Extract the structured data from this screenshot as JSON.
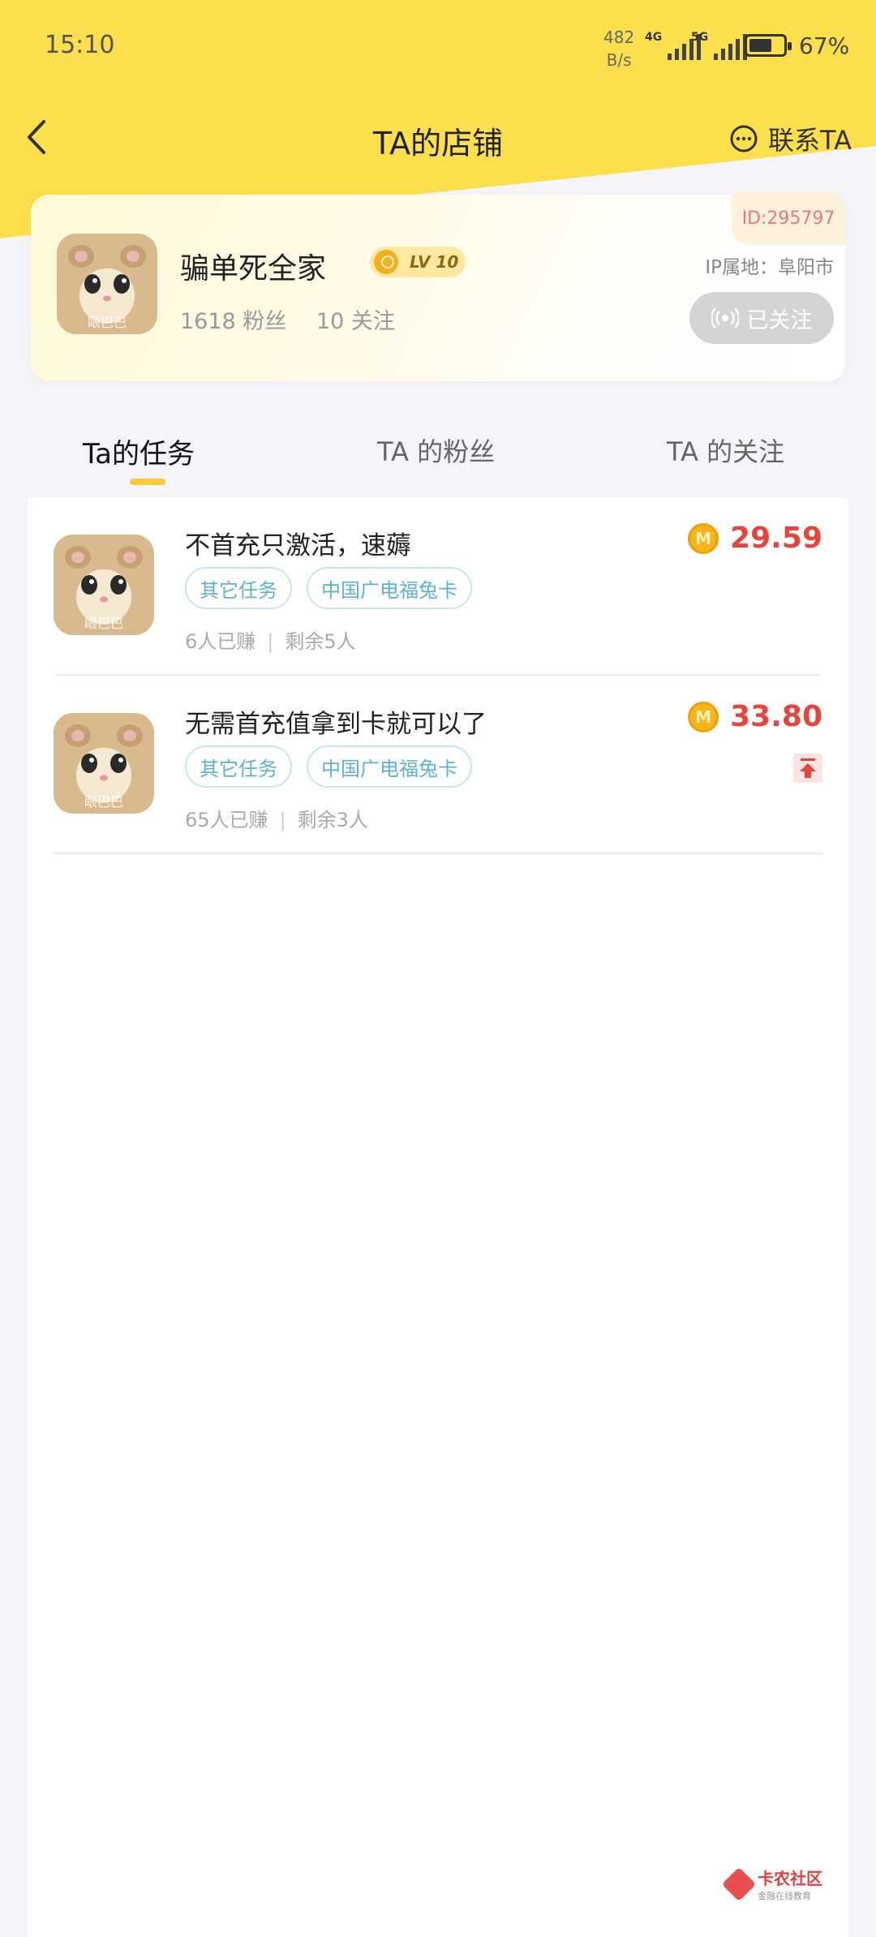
{
  "status": {
    "time": "15:10",
    "net_speed_value": "482",
    "net_speed_unit": "B/s",
    "signal1": "4G",
    "signal2": "5G",
    "battery_level": 0.67,
    "battery": "67%"
  },
  "nav": {
    "title": "TA的店铺",
    "contact_label": "联系TA"
  },
  "profile": {
    "id": "ID:295797",
    "name": "骗单死全家",
    "level": "LV 10",
    "fans": "1618 粉丝",
    "follows": "10 关注",
    "ip": "IP属地：阜阳市",
    "follow_state": "已关注",
    "avatar_watermark": "眼巴巴"
  },
  "tabs": [
    {
      "label": "Ta的任务",
      "active": true
    },
    {
      "label": "TA 的粉丝",
      "active": false
    },
    {
      "label": "TA 的关注",
      "active": false
    }
  ],
  "tasks": [
    {
      "title": "不首充只激活，速薅",
      "tags": [
        "其它任务",
        "中国广电福兔卡"
      ],
      "earned": "6人已赚",
      "remaining": "剩余5人",
      "amount": "29.59",
      "pinned": false
    },
    {
      "title": "无需首充值拿到卡就可以了",
      "tags": [
        "其它任务",
        "中国广电福兔卡"
      ],
      "earned": "65人已赚",
      "remaining": "剩余3人",
      "amount": "33.80",
      "pinned": true
    }
  ],
  "coin_symbol": "M",
  "watermark": {
    "main": "卡农社区",
    "sub": "金融在线教育"
  }
}
